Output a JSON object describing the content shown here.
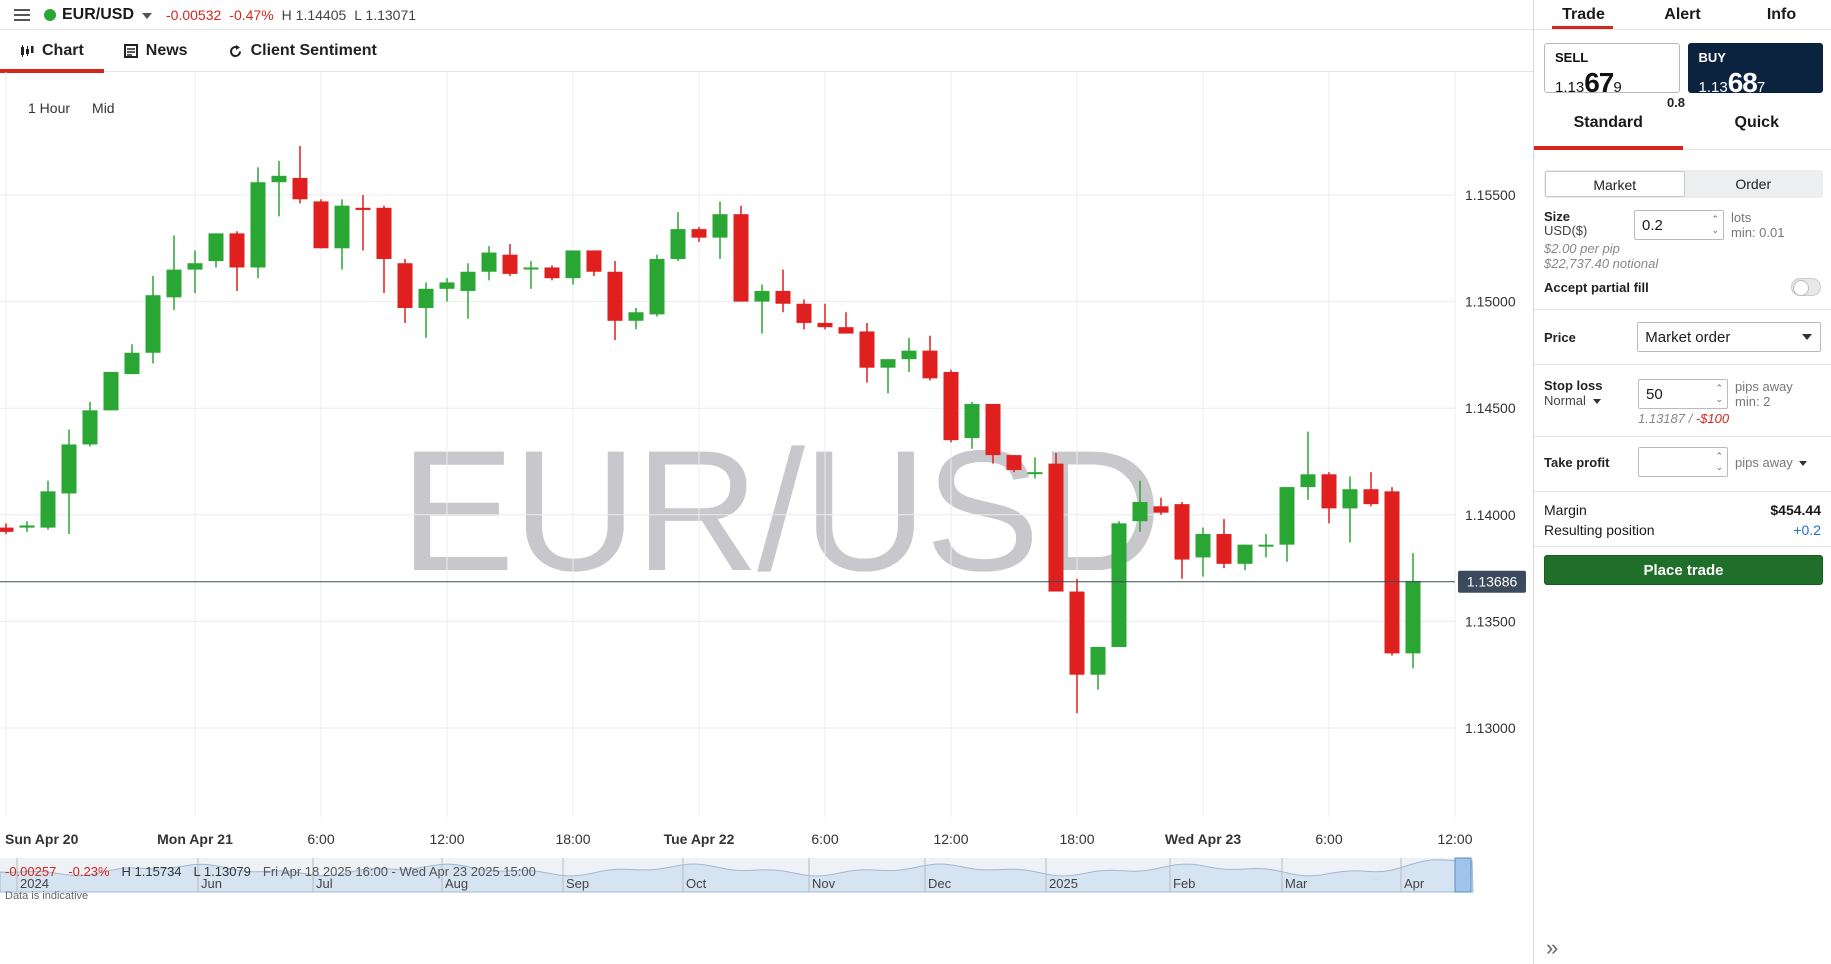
{
  "topbar": {
    "symbol": "EUR/USD",
    "change": "-0.00532",
    "change_pct": "-0.47%",
    "high": "H 1.14405",
    "low": "L 1.13071",
    "status_color": "#2aa634"
  },
  "chart_tabs": [
    {
      "label": "Chart",
      "icon": "candles-icon"
    },
    {
      "label": "News",
      "icon": "newspaper-icon"
    },
    {
      "label": "Client Sentiment",
      "icon": "refresh-icon"
    }
  ],
  "chart_options": {
    "interval": "1 Hour",
    "price_type": "Mid"
  },
  "watermark": "EUR/USD",
  "chart_footer": {
    "change": "-0.00257",
    "change_pct": "-0.23%",
    "high": "H 1.15734",
    "low": "L 1.13079",
    "range": "Fri Apr 18 2025 16:00 - Wed Apr 23 2025 15:00",
    "indicative": "Data is indicative"
  },
  "chart_data": {
    "type": "candlestick",
    "title": "EUR/USD",
    "interval": "1 Hour",
    "ylim": [
      1.1275,
      1.1585
    ],
    "y_ticks": [
      "1.15500",
      "1.15000",
      "1.14500",
      "1.14000",
      "1.13500",
      "1.13000"
    ],
    "y_tick_values": [
      1.155,
      1.15,
      1.145,
      1.14,
      1.135,
      1.13
    ],
    "x_ticks": [
      "Sun Apr 20",
      "Mon Apr 21",
      "6:00",
      "12:00",
      "18:00",
      "Tue Apr 22",
      "6:00",
      "12:00",
      "18:00",
      "Wed Apr 23",
      "6:00",
      "12:00"
    ],
    "x_tick_slots": [
      0,
      9,
      15,
      21,
      27,
      33,
      39,
      45,
      51,
      57,
      63,
      69
    ],
    "current_price": "1.13686",
    "current_value": 1.13686,
    "up_color": "#2aa634",
    "down_color": "#e01f1f",
    "candles": [
      {
        "o": 1.1394,
        "h": 1.1396,
        "l": 1.1391,
        "c": 1.1392
      },
      {
        "o": 1.1394,
        "h": 1.1397,
        "l": 1.1392,
        "c": 1.1395
      },
      {
        "o": 1.1394,
        "h": 1.1416,
        "l": 1.1393,
        "c": 1.1411
      },
      {
        "o": 1.141,
        "h": 1.144,
        "l": 1.1391,
        "c": 1.1433
      },
      {
        "o": 1.1433,
        "h": 1.1453,
        "l": 1.1432,
        "c": 1.1449
      },
      {
        "o": 1.1449,
        "h": 1.1467,
        "l": 1.1449,
        "c": 1.1467
      },
      {
        "o": 1.1466,
        "h": 1.148,
        "l": 1.1466,
        "c": 1.1476
      },
      {
        "o": 1.1476,
        "h": 1.1512,
        "l": 1.1471,
        "c": 1.1503
      },
      {
        "o": 1.1502,
        "h": 1.1531,
        "l": 1.1496,
        "c": 1.1515
      },
      {
        "o": 1.1515,
        "h": 1.1524,
        "l": 1.1504,
        "c": 1.1518
      },
      {
        "o": 1.1519,
        "h": 1.1532,
        "l": 1.1516,
        "c": 1.1532
      },
      {
        "o": 1.1532,
        "h": 1.1533,
        "l": 1.1505,
        "c": 1.1516
      },
      {
        "o": 1.1516,
        "h": 1.1563,
        "l": 1.1511,
        "c": 1.1556
      },
      {
        "o": 1.1556,
        "h": 1.1566,
        "l": 1.154,
        "c": 1.1559
      },
      {
        "o": 1.1558,
        "h": 1.1573,
        "l": 1.1546,
        "c": 1.1548
      },
      {
        "o": 1.1547,
        "h": 1.1548,
        "l": 1.1525,
        "c": 1.1525
      },
      {
        "o": 1.1525,
        "h": 1.1548,
        "l": 1.1515,
        "c": 1.1545
      },
      {
        "o": 1.1544,
        "h": 1.155,
        "l": 1.1524,
        "c": 1.1543
      },
      {
        "o": 1.1544,
        "h": 1.1545,
        "l": 1.1504,
        "c": 1.152
      },
      {
        "o": 1.1518,
        "h": 1.152,
        "l": 1.149,
        "c": 1.1497
      },
      {
        "o": 1.1497,
        "h": 1.1509,
        "l": 1.1483,
        "c": 1.1506
      },
      {
        "o": 1.1506,
        "h": 1.1511,
        "l": 1.15,
        "c": 1.1509
      },
      {
        "o": 1.1505,
        "h": 1.1518,
        "l": 1.1492,
        "c": 1.1514
      },
      {
        "o": 1.1514,
        "h": 1.1526,
        "l": 1.151,
        "c": 1.1523
      },
      {
        "o": 1.1522,
        "h": 1.1527,
        "l": 1.1512,
        "c": 1.1513
      },
      {
        "o": 1.1516,
        "h": 1.1519,
        "l": 1.1506,
        "c": 1.1516
      },
      {
        "o": 1.1516,
        "h": 1.1517,
        "l": 1.151,
        "c": 1.1511
      },
      {
        "o": 1.1511,
        "h": 1.1524,
        "l": 1.1508,
        "c": 1.1524
      },
      {
        "o": 1.1524,
        "h": 1.1524,
        "l": 1.1512,
        "c": 1.1514
      },
      {
        "o": 1.1514,
        "h": 1.1519,
        "l": 1.1482,
        "c": 1.1491
      },
      {
        "o": 1.1491,
        "h": 1.1497,
        "l": 1.1487,
        "c": 1.1495
      },
      {
        "o": 1.1494,
        "h": 1.1522,
        "l": 1.1493,
        "c": 1.152
      },
      {
        "o": 1.152,
        "h": 1.1542,
        "l": 1.1519,
        "c": 1.1534
      },
      {
        "o": 1.1534,
        "h": 1.1535,
        "l": 1.1528,
        "c": 1.153
      },
      {
        "o": 1.153,
        "h": 1.1547,
        "l": 1.152,
        "c": 1.1541
      },
      {
        "o": 1.1541,
        "h": 1.1545,
        "l": 1.15,
        "c": 1.15
      },
      {
        "o": 1.15,
        "h": 1.1508,
        "l": 1.1485,
        "c": 1.1505
      },
      {
        "o": 1.1505,
        "h": 1.1515,
        "l": 1.1495,
        "c": 1.1499
      },
      {
        "o": 1.1499,
        "h": 1.1501,
        "l": 1.1487,
        "c": 1.149
      },
      {
        "o": 1.149,
        "h": 1.1499,
        "l": 1.1487,
        "c": 1.1488
      },
      {
        "o": 1.1488,
        "h": 1.1495,
        "l": 1.1485,
        "c": 1.1485
      },
      {
        "o": 1.1486,
        "h": 1.149,
        "l": 1.1462,
        "c": 1.1469
      },
      {
        "o": 1.1469,
        "h": 1.1471,
        "l": 1.1457,
        "c": 1.1473
      },
      {
        "o": 1.1473,
        "h": 1.1483,
        "l": 1.1467,
        "c": 1.1477
      },
      {
        "o": 1.1477,
        "h": 1.1484,
        "l": 1.1463,
        "c": 1.1464
      },
      {
        "o": 1.1467,
        "h": 1.1468,
        "l": 1.1434,
        "c": 1.1435
      },
      {
        "o": 1.1436,
        "h": 1.1453,
        "l": 1.1431,
        "c": 1.1452
      },
      {
        "o": 1.1452,
        "h": 1.1452,
        "l": 1.1424,
        "c": 1.1428
      },
      {
        "o": 1.1428,
        "h": 1.1428,
        "l": 1.142,
        "c": 1.1421
      },
      {
        "o": 1.142,
        "h": 1.1427,
        "l": 1.1417,
        "c": 1.142
      },
      {
        "o": 1.1424,
        "h": 1.1429,
        "l": 1.1364,
        "c": 1.1364
      },
      {
        "o": 1.1364,
        "h": 1.137,
        "l": 1.1307,
        "c": 1.1325
      },
      {
        "o": 1.1325,
        "h": 1.1337,
        "l": 1.1318,
        "c": 1.1338
      },
      {
        "o": 1.1338,
        "h": 1.1397,
        "l": 1.1338,
        "c": 1.1396
      },
      {
        "o": 1.1397,
        "h": 1.1416,
        "l": 1.1392,
        "c": 1.1406
      },
      {
        "o": 1.1404,
        "h": 1.1408,
        "l": 1.14,
        "c": 1.1401
      },
      {
        "o": 1.1405,
        "h": 1.1406,
        "l": 1.137,
        "c": 1.1379
      },
      {
        "o": 1.138,
        "h": 1.1394,
        "l": 1.1371,
        "c": 1.1391
      },
      {
        "o": 1.1391,
        "h": 1.1398,
        "l": 1.1375,
        "c": 1.1377
      },
      {
        "o": 1.1377,
        "h": 1.1386,
        "l": 1.1374,
        "c": 1.1386
      },
      {
        "o": 1.1386,
        "h": 1.1391,
        "l": 1.138,
        "c": 1.1386
      },
      {
        "o": 1.1386,
        "h": 1.1413,
        "l": 1.1378,
        "c": 1.1413
      },
      {
        "o": 1.1413,
        "h": 1.1439,
        "l": 1.1407,
        "c": 1.1419
      },
      {
        "o": 1.1419,
        "h": 1.142,
        "l": 1.1396,
        "c": 1.1403
      },
      {
        "o": 1.1403,
        "h": 1.1418,
        "l": 1.1387,
        "c": 1.1412
      },
      {
        "o": 1.1412,
        "h": 1.142,
        "l": 1.1404,
        "c": 1.1405
      },
      {
        "o": 1.1411,
        "h": 1.1413,
        "l": 1.1334,
        "c": 1.1335
      },
      {
        "o": 1.1335,
        "h": 1.1382,
        "l": 1.1328,
        "c": 1.1369
      }
    ]
  },
  "navigator": {
    "labels": [
      "2024",
      "Jun",
      "Jul",
      "Aug",
      "Sep",
      "Oct",
      "Nov",
      "Dec",
      "2025",
      "Feb",
      "Mar",
      "Apr"
    ]
  },
  "panel": {
    "tabs": [
      "Trade",
      "Alert",
      "Info"
    ],
    "sell": {
      "label": "SELL",
      "prefix": "1.13",
      "big": "67",
      "suffix": "9"
    },
    "buy": {
      "label": "BUY",
      "prefix": "1.13",
      "big": "68",
      "suffix": "7"
    },
    "spread": "0.8",
    "order_tabs": [
      "Standard",
      "Quick"
    ],
    "order_types": [
      "Market",
      "Order"
    ],
    "size": {
      "label": "Size",
      "sub": "USD($)",
      "value": "0.2",
      "unit": "lots",
      "min": "min: 0.01",
      "per_pip": "$2.00 per pip",
      "notional": "$22,737.40 notional"
    },
    "partial_fill": "Accept partial fill",
    "price": {
      "label": "Price",
      "value": "Market order"
    },
    "stop_loss": {
      "label": "Stop loss",
      "type": "Normal",
      "value": "50",
      "unit": "pips away",
      "min": "min: 2",
      "level": "1.13187",
      "sep": " / ",
      "amount": "-$100"
    },
    "take_profit": {
      "label": "Take profit",
      "value": "",
      "unit": "pips away"
    },
    "margin": {
      "label": "Margin",
      "value": "$454.44"
    },
    "resulting": {
      "label": "Resulting position",
      "value": "+0.2"
    },
    "place_label": "Place trade",
    "brand_color": "#1f6f2a",
    "accent_color": "#d4261c"
  }
}
